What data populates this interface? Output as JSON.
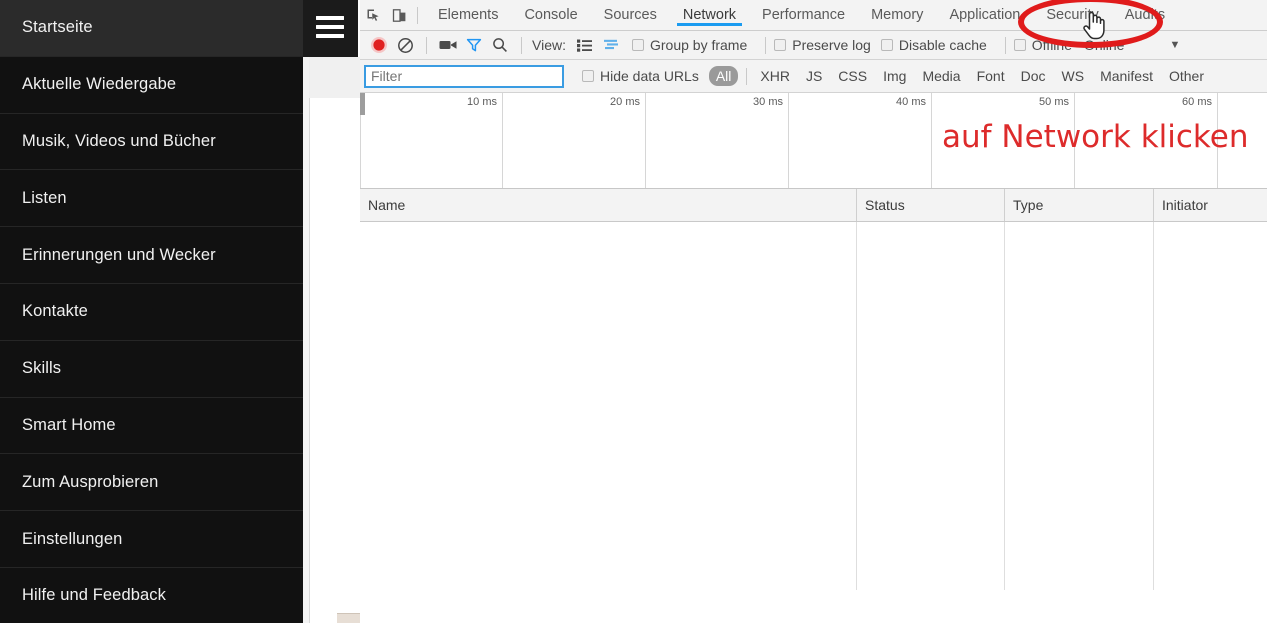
{
  "app": {
    "hamburger_icon": "hamburger-menu-icon",
    "sidebar": {
      "items": [
        {
          "label": "Startseite",
          "selected": true
        },
        {
          "label": "Aktuelle Wiedergabe",
          "selected": false
        },
        {
          "label": "Musik, Videos und Bücher",
          "selected": false
        },
        {
          "label": "Listen",
          "selected": false
        },
        {
          "label": "Erinnerungen und Wecker",
          "selected": false
        },
        {
          "label": "Kontakte",
          "selected": false
        },
        {
          "label": "Skills",
          "selected": false
        },
        {
          "label": "Smart Home",
          "selected": false
        },
        {
          "label": "Zum Ausprobieren",
          "selected": false
        },
        {
          "label": "Einstellungen",
          "selected": false
        },
        {
          "label": "Hilfe und Feedback",
          "selected": false
        }
      ]
    }
  },
  "devtools": {
    "left_icons": [
      {
        "name": "inspect-element-icon",
        "title": "Inspect"
      },
      {
        "name": "device-toolbar-icon",
        "title": "Toggle device toolbar"
      }
    ],
    "tabs": [
      {
        "label": "Elements",
        "active": false
      },
      {
        "label": "Console",
        "active": false
      },
      {
        "label": "Sources",
        "active": false
      },
      {
        "label": "Network",
        "active": true
      },
      {
        "label": "Performance",
        "active": false
      },
      {
        "label": "Memory",
        "active": false
      },
      {
        "label": "Application",
        "active": false
      },
      {
        "label": "Security",
        "active": false
      },
      {
        "label": "Audits",
        "active": false
      }
    ],
    "toolbar": {
      "record_icon": "record-button-icon",
      "clear_icon": "clear-icon",
      "camera_icon": "screenshot-camera-icon",
      "filter_icon": "filter-funnel-icon",
      "search_icon": "search-magnifier-icon",
      "view_label": "View:",
      "view_list_icon": "view-list-icon",
      "view_waterfall_icon": "view-waterfall-icon",
      "group_by_frame_label": "Group by frame",
      "preserve_log_label": "Preserve log",
      "disable_cache_label": "Disable cache",
      "offline_label": "Offline",
      "throttling_value": "Online",
      "throttling_caret_icon": "chevron-down-icon"
    },
    "filterbar": {
      "filter_placeholder": "Filter",
      "filter_value": "",
      "hide_data_urls_label": "Hide data URLs",
      "types": [
        {
          "label": "All",
          "selected": true
        },
        {
          "label": "XHR",
          "selected": false
        },
        {
          "label": "JS",
          "selected": false
        },
        {
          "label": "CSS",
          "selected": false
        },
        {
          "label": "Img",
          "selected": false
        },
        {
          "label": "Media",
          "selected": false
        },
        {
          "label": "Font",
          "selected": false
        },
        {
          "label": "Doc",
          "selected": false
        },
        {
          "label": "WS",
          "selected": false
        },
        {
          "label": "Manifest",
          "selected": false
        },
        {
          "label": "Other",
          "selected": false
        }
      ]
    },
    "overview": {
      "ticks": [
        "10 ms",
        "20 ms",
        "30 ms",
        "40 ms",
        "50 ms",
        "60 ms"
      ]
    },
    "table": {
      "columns": [
        "Name",
        "Status",
        "Type",
        "Initiator"
      ],
      "rows": []
    }
  },
  "annotation": {
    "text": "auf Network klicken",
    "color": "#dd2b2b",
    "ellipse_target": "Network",
    "cursor_icon": "pointer-hand-cursor"
  }
}
